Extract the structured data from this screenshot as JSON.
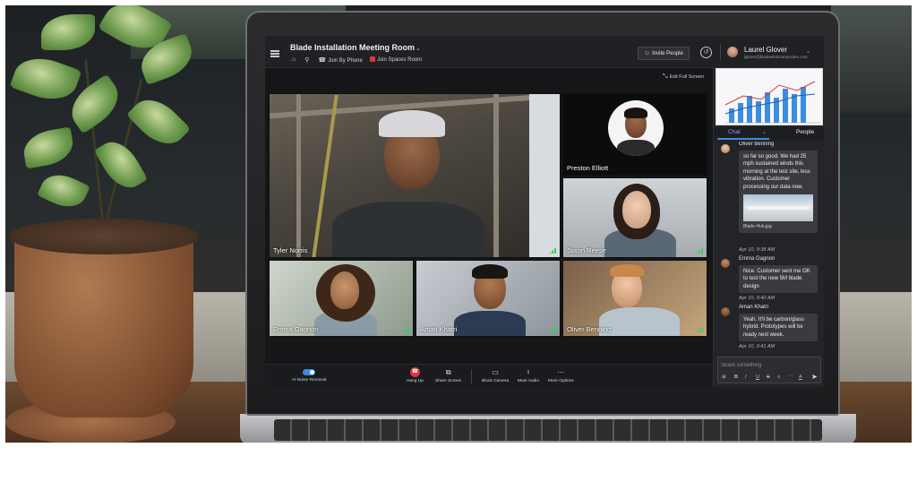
{
  "meeting": {
    "title": "Blade Installation Meeting Room",
    "join_by_phone": "Join By Phone",
    "join_spaces_room": "Join Spaces Room",
    "invite_label": "Invite People",
    "exit_fullscreen": "Exit Full Screen"
  },
  "user": {
    "name": "Laurel Glover",
    "email": "lglover@bladewindcomposites.com"
  },
  "participants": [
    {
      "name": "Tyler Norris"
    },
    {
      "name": "Preston Elliott"
    },
    {
      "name": "Jaxon Reese"
    },
    {
      "name": "Emma Gagnon"
    },
    {
      "name": "Aman Khatri"
    },
    {
      "name": "Oliver Benning"
    }
  ],
  "toolbar": {
    "noise_removal": "AI Noise Removal",
    "hang_up": "Hang Up",
    "share_screen": "Share Screen",
    "block_camera": "Block Camera",
    "mute_audio": "Mute Audio",
    "more_options": "More Options"
  },
  "panel": {
    "tab_chat": "Chat",
    "tab_people": "People",
    "compose_placeholder": "Share something"
  },
  "chat": [
    {
      "sender": "Oliver Benning",
      "text": "so far so good. We had 25 mph sustained winds this morning at the test site, less vibration. Customer processing our data now.",
      "attachment": "Blade-Hub.jpg",
      "time": "Apr 10, 9:38 AM"
    },
    {
      "sender": "Emma Gagnon",
      "text": "Nice. Customer sent me OK to test the new 5M blade design",
      "time": "Apr 10, 9:40 AM"
    },
    {
      "sender": "Aman Khatri",
      "text": "Yeah.  It'll be carbon/glass hybrid. Prototypes will be ready next week.",
      "time": "Apr 10, 9:41 AM"
    }
  ],
  "colors": {
    "accent": "#3a8de0",
    "hangup": "#e0343b",
    "signal": "#3ccf5a"
  }
}
